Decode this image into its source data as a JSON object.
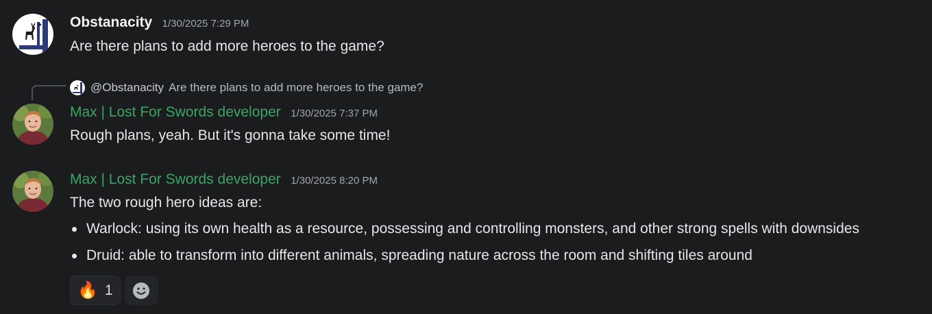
{
  "messages": [
    {
      "username": "Obstanacity",
      "timestamp": "1/30/2025 7:29 PM",
      "text": "Are there plans to add more heroes to the game?",
      "avatar_icon": "deer-flag-avatar"
    },
    {
      "reply": {
        "mention": "@Obstanacity",
        "text": "Are there plans to add more heroes to the game?",
        "avatar_icon": "deer-flag-avatar"
      },
      "username": "Max | Lost For Swords developer",
      "timestamp": "1/30/2025 7:37 PM",
      "text": "Rough plans, yeah. But it's gonna take some time!",
      "avatar_icon": "person-avatar"
    },
    {
      "username": "Max | Lost For Swords developer",
      "timestamp": "1/30/2025 8:20 PM",
      "text": "The two rough hero ideas are:",
      "bullets": [
        "Warlock: using its own health as a resource, possessing and controlling monsters, and other strong spells with downsides",
        "Druid: able to transform into different animals, spreading nature across the room and shifting tiles around"
      ],
      "avatar_icon": "person-avatar",
      "reactions": [
        {
          "emoji": "🔥",
          "count": "1"
        }
      ],
      "add_reaction_icon": "smiley-icon"
    }
  ],
  "colors": {
    "background": "#1a1c1e",
    "developer_name": "#3aa664",
    "username": "#f2f3f5",
    "timestamp": "#a2a6ad"
  }
}
